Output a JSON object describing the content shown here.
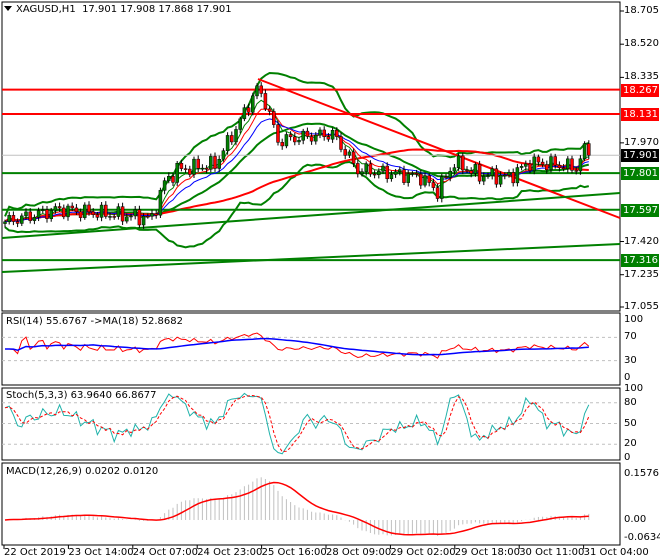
{
  "header": {
    "symbol": "XAGUSD,H1",
    "ohlc": "17.901 17.908 17.868 17.901"
  },
  "colors": {
    "bull": "#008000",
    "bear": "#ff0000",
    "support": "#008000",
    "resistance": "#ff0000",
    "rsi": "#ff0000",
    "rsi_ma": "#0000ff",
    "stoch_main": "#20b2aa",
    "stoch_signal": "#ff0000",
    "macd_hist": "#c0c0c0",
    "macd_signal": "#ff0000"
  },
  "price_axis": [
    "18.705",
    "18.520",
    "18.335",
    "17.970",
    "17.420",
    "17.235",
    "17.055"
  ],
  "price_tags": [
    {
      "label": "18.267",
      "price": 18.267,
      "color": "#ff0000"
    },
    {
      "label": "18.131",
      "price": 18.131,
      "color": "#ff0000"
    },
    {
      "label": "17.901",
      "price": 17.901,
      "color": "#000000"
    },
    {
      "label": "17.801",
      "price": 17.801,
      "color": "#008000"
    },
    {
      "label": "17.597",
      "price": 17.597,
      "color": "#008000"
    },
    {
      "label": "17.316",
      "price": 17.316,
      "color": "#008000"
    }
  ],
  "indicators": {
    "rsi": {
      "label": "RSI(14) 55.6767  ->MA(18) 52.8682",
      "axis": [
        "100",
        "70",
        "30",
        "0"
      ]
    },
    "stoch": {
      "label": "Stoch(5,3,3) 63.9640 66.8677",
      "axis": [
        "100",
        "80",
        "50",
        "20",
        "0"
      ]
    },
    "macd": {
      "label": "MACD(12,26,9) 0.0202 0.0120",
      "axis": [
        "0.1576",
        "0.00",
        "-0.0634"
      ]
    }
  },
  "time_axis": [
    "22 Oct 2019",
    "23 Oct 14:00",
    "24 Oct 07:00",
    "24 Oct 23:00",
    "25 Oct 16:00",
    "28 Oct 09:00",
    "29 Oct 02:00",
    "29 Oct 18:00",
    "30 Oct 11:00",
    "31 Oct 04:00"
  ],
  "chart_data": {
    "type": "candlestick",
    "title": "XAGUSD,H1",
    "ylim": [
      17.055,
      18.705
    ],
    "bars": 140,
    "close_path": [
      [
        0,
        17.53
      ],
      [
        13,
        17.6
      ],
      [
        35,
        17.55
      ],
      [
        38,
        17.75
      ],
      [
        41,
        17.82
      ],
      [
        50,
        17.85
      ],
      [
        55,
        18.05
      ],
      [
        60,
        18.27
      ],
      [
        62,
        18.2
      ],
      [
        65,
        17.98
      ],
      [
        70,
        18.0
      ],
      [
        78,
        18.02
      ],
      [
        81,
        17.92
      ],
      [
        84,
        17.82
      ],
      [
        92,
        17.8
      ],
      [
        99,
        17.78
      ],
      [
        103,
        17.7
      ],
      [
        107,
        17.86
      ],
      [
        113,
        17.79
      ],
      [
        120,
        17.78
      ],
      [
        125,
        17.86
      ],
      [
        131,
        17.85
      ],
      [
        136,
        17.83
      ],
      [
        138,
        17.93
      ],
      [
        139,
        17.901
      ]
    ],
    "horizontal_levels": [
      18.267,
      18.131,
      17.801,
      17.597,
      17.316
    ]
  }
}
